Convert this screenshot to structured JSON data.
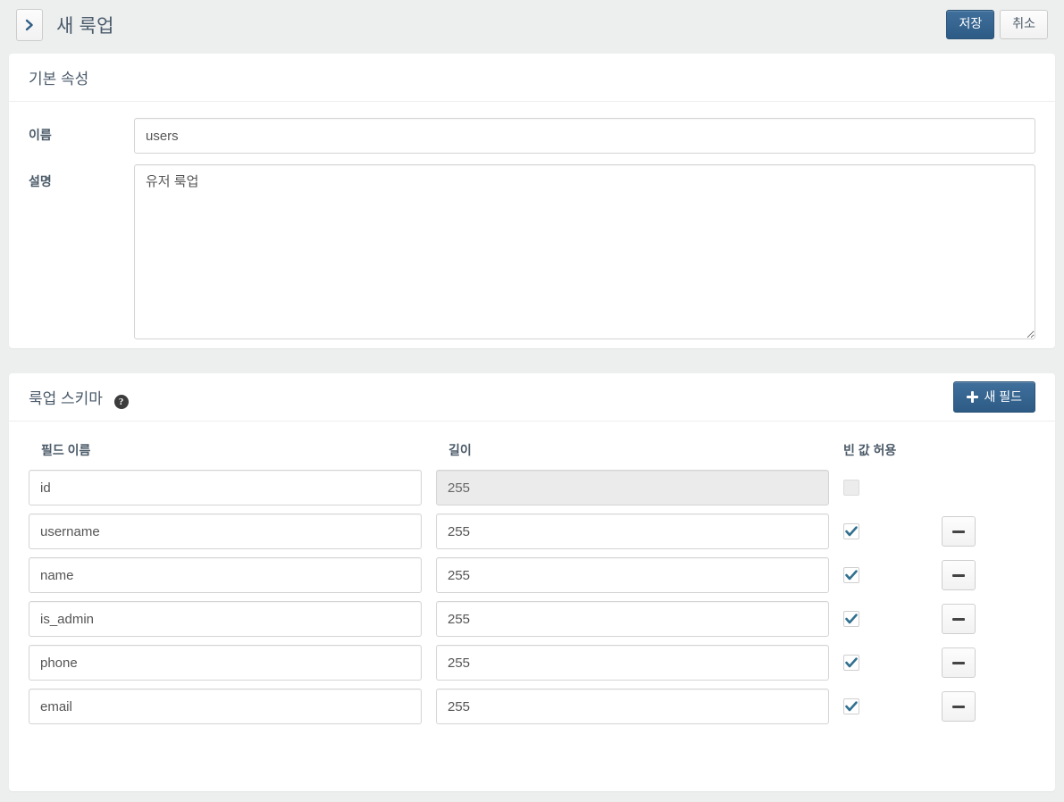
{
  "header": {
    "back_icon": "chevron-right-icon",
    "title": "새 룩업",
    "save_label": "저장",
    "cancel_label": "취소"
  },
  "basic_panel": {
    "title": "기본 속성",
    "name_label": "이름",
    "name_value": "users",
    "name_placeholder": "",
    "desc_label": "설명",
    "desc_value": "유저 룩업",
    "desc_placeholder": ""
  },
  "schema_panel": {
    "title": "룩업 스키마",
    "help_icon": "question-mark-icon",
    "help_glyph": "?",
    "new_field_label": "새 필드",
    "new_field_icon": "plus-icon",
    "columns": {
      "field_name": "필드 이름",
      "length": "길이",
      "nullable": "빈 값 허용"
    },
    "remove_icon": "minus-icon",
    "rows": [
      {
        "field_name": "id",
        "length": "255",
        "nullable": false,
        "disabled": true,
        "removable": false
      },
      {
        "field_name": "username",
        "length": "255",
        "nullable": true,
        "disabled": false,
        "removable": true
      },
      {
        "field_name": "name",
        "length": "255",
        "nullable": true,
        "disabled": false,
        "removable": true
      },
      {
        "field_name": "is_admin",
        "length": "255",
        "nullable": true,
        "disabled": false,
        "removable": true
      },
      {
        "field_name": "phone",
        "length": "255",
        "nullable": true,
        "disabled": false,
        "removable": true
      },
      {
        "field_name": "email",
        "length": "255",
        "nullable": true,
        "disabled": false,
        "removable": true
      }
    ]
  },
  "colors": {
    "page_bg": "#ecefee",
    "panel_bg": "#ffffff",
    "primary": "#2d5b86",
    "title_text": "#4a5a6a",
    "check": "#31708f"
  }
}
